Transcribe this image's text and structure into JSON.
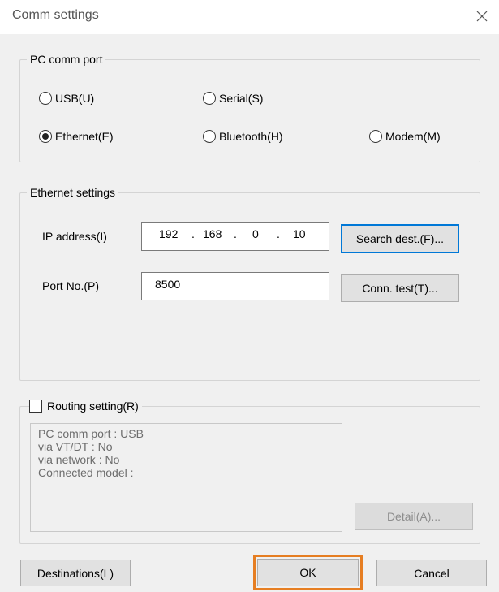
{
  "window": {
    "title": "Comm settings",
    "close_glyph": "✕"
  },
  "pc_comm_port": {
    "legend": "PC comm port",
    "options": [
      {
        "label": "USB(U)",
        "checked": false
      },
      {
        "label": "Serial(S)",
        "checked": false
      },
      {
        "label": "Ethernet(E)",
        "checked": true
      },
      {
        "label": "Bluetooth(H)",
        "checked": false
      },
      {
        "label": "Modem(M)",
        "checked": false
      }
    ]
  },
  "ethernet_settings": {
    "legend": "Ethernet settings",
    "ip_label": "IP address(I)",
    "ip_octets": [
      "192",
      "168",
      "0",
      "10"
    ],
    "ip_separator": ".",
    "port_label": "Port No.(P)",
    "port_value": "8500",
    "search_button": "Search dest.(F)...",
    "conn_test_button": "Conn. test(T)..."
  },
  "routing": {
    "checkbox_label": "Routing setting(R)",
    "checked": false,
    "info_lines": [
      "PC comm port : USB",
      "via VT/DT : No",
      "via network : No",
      "Connected model :"
    ],
    "detail_button": "Detail(A)..."
  },
  "footer": {
    "destinations_button": "Destinations(L)",
    "ok_button": "OK",
    "cancel_button": "Cancel"
  },
  "colors": {
    "default_button_border": "#0078d7",
    "highlight_border": "#e67e22"
  }
}
